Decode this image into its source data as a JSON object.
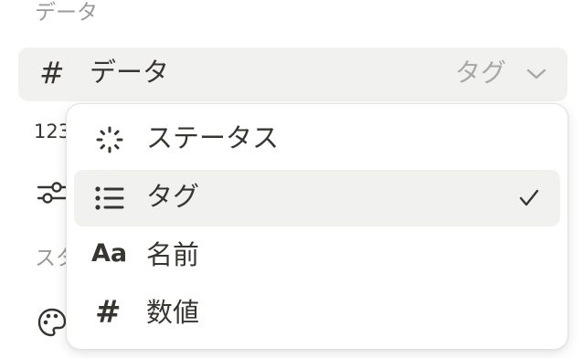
{
  "sections": {
    "data_label": "データ",
    "style_label": "スタ"
  },
  "property": {
    "icon": "hash-icon",
    "icon_glyph": "#",
    "name": "データ",
    "type": "タグ",
    "chevron_icon": "chevron-down-icon"
  },
  "background": {
    "number_icon_text": "123",
    "sliders_icon": "sliders-icon",
    "palette_icon": "palette-icon"
  },
  "dropdown": {
    "options": [
      {
        "label": "ステータス",
        "icon": "status-icon",
        "selected": false
      },
      {
        "label": "タグ",
        "icon": "list-icon",
        "selected": true
      },
      {
        "label": "名前",
        "icon": "text-aa-icon",
        "icon_text": "Aa",
        "selected": false
      },
      {
        "label": "数値",
        "icon": "hash-icon",
        "icon_text": "#",
        "selected": false
      }
    ],
    "check_icon": "checkmark-icon"
  },
  "colors": {
    "text": "#37352f",
    "muted": "#9b9a97",
    "row_bg": "#f1f1ef",
    "type_text": "#a9a8a4"
  }
}
